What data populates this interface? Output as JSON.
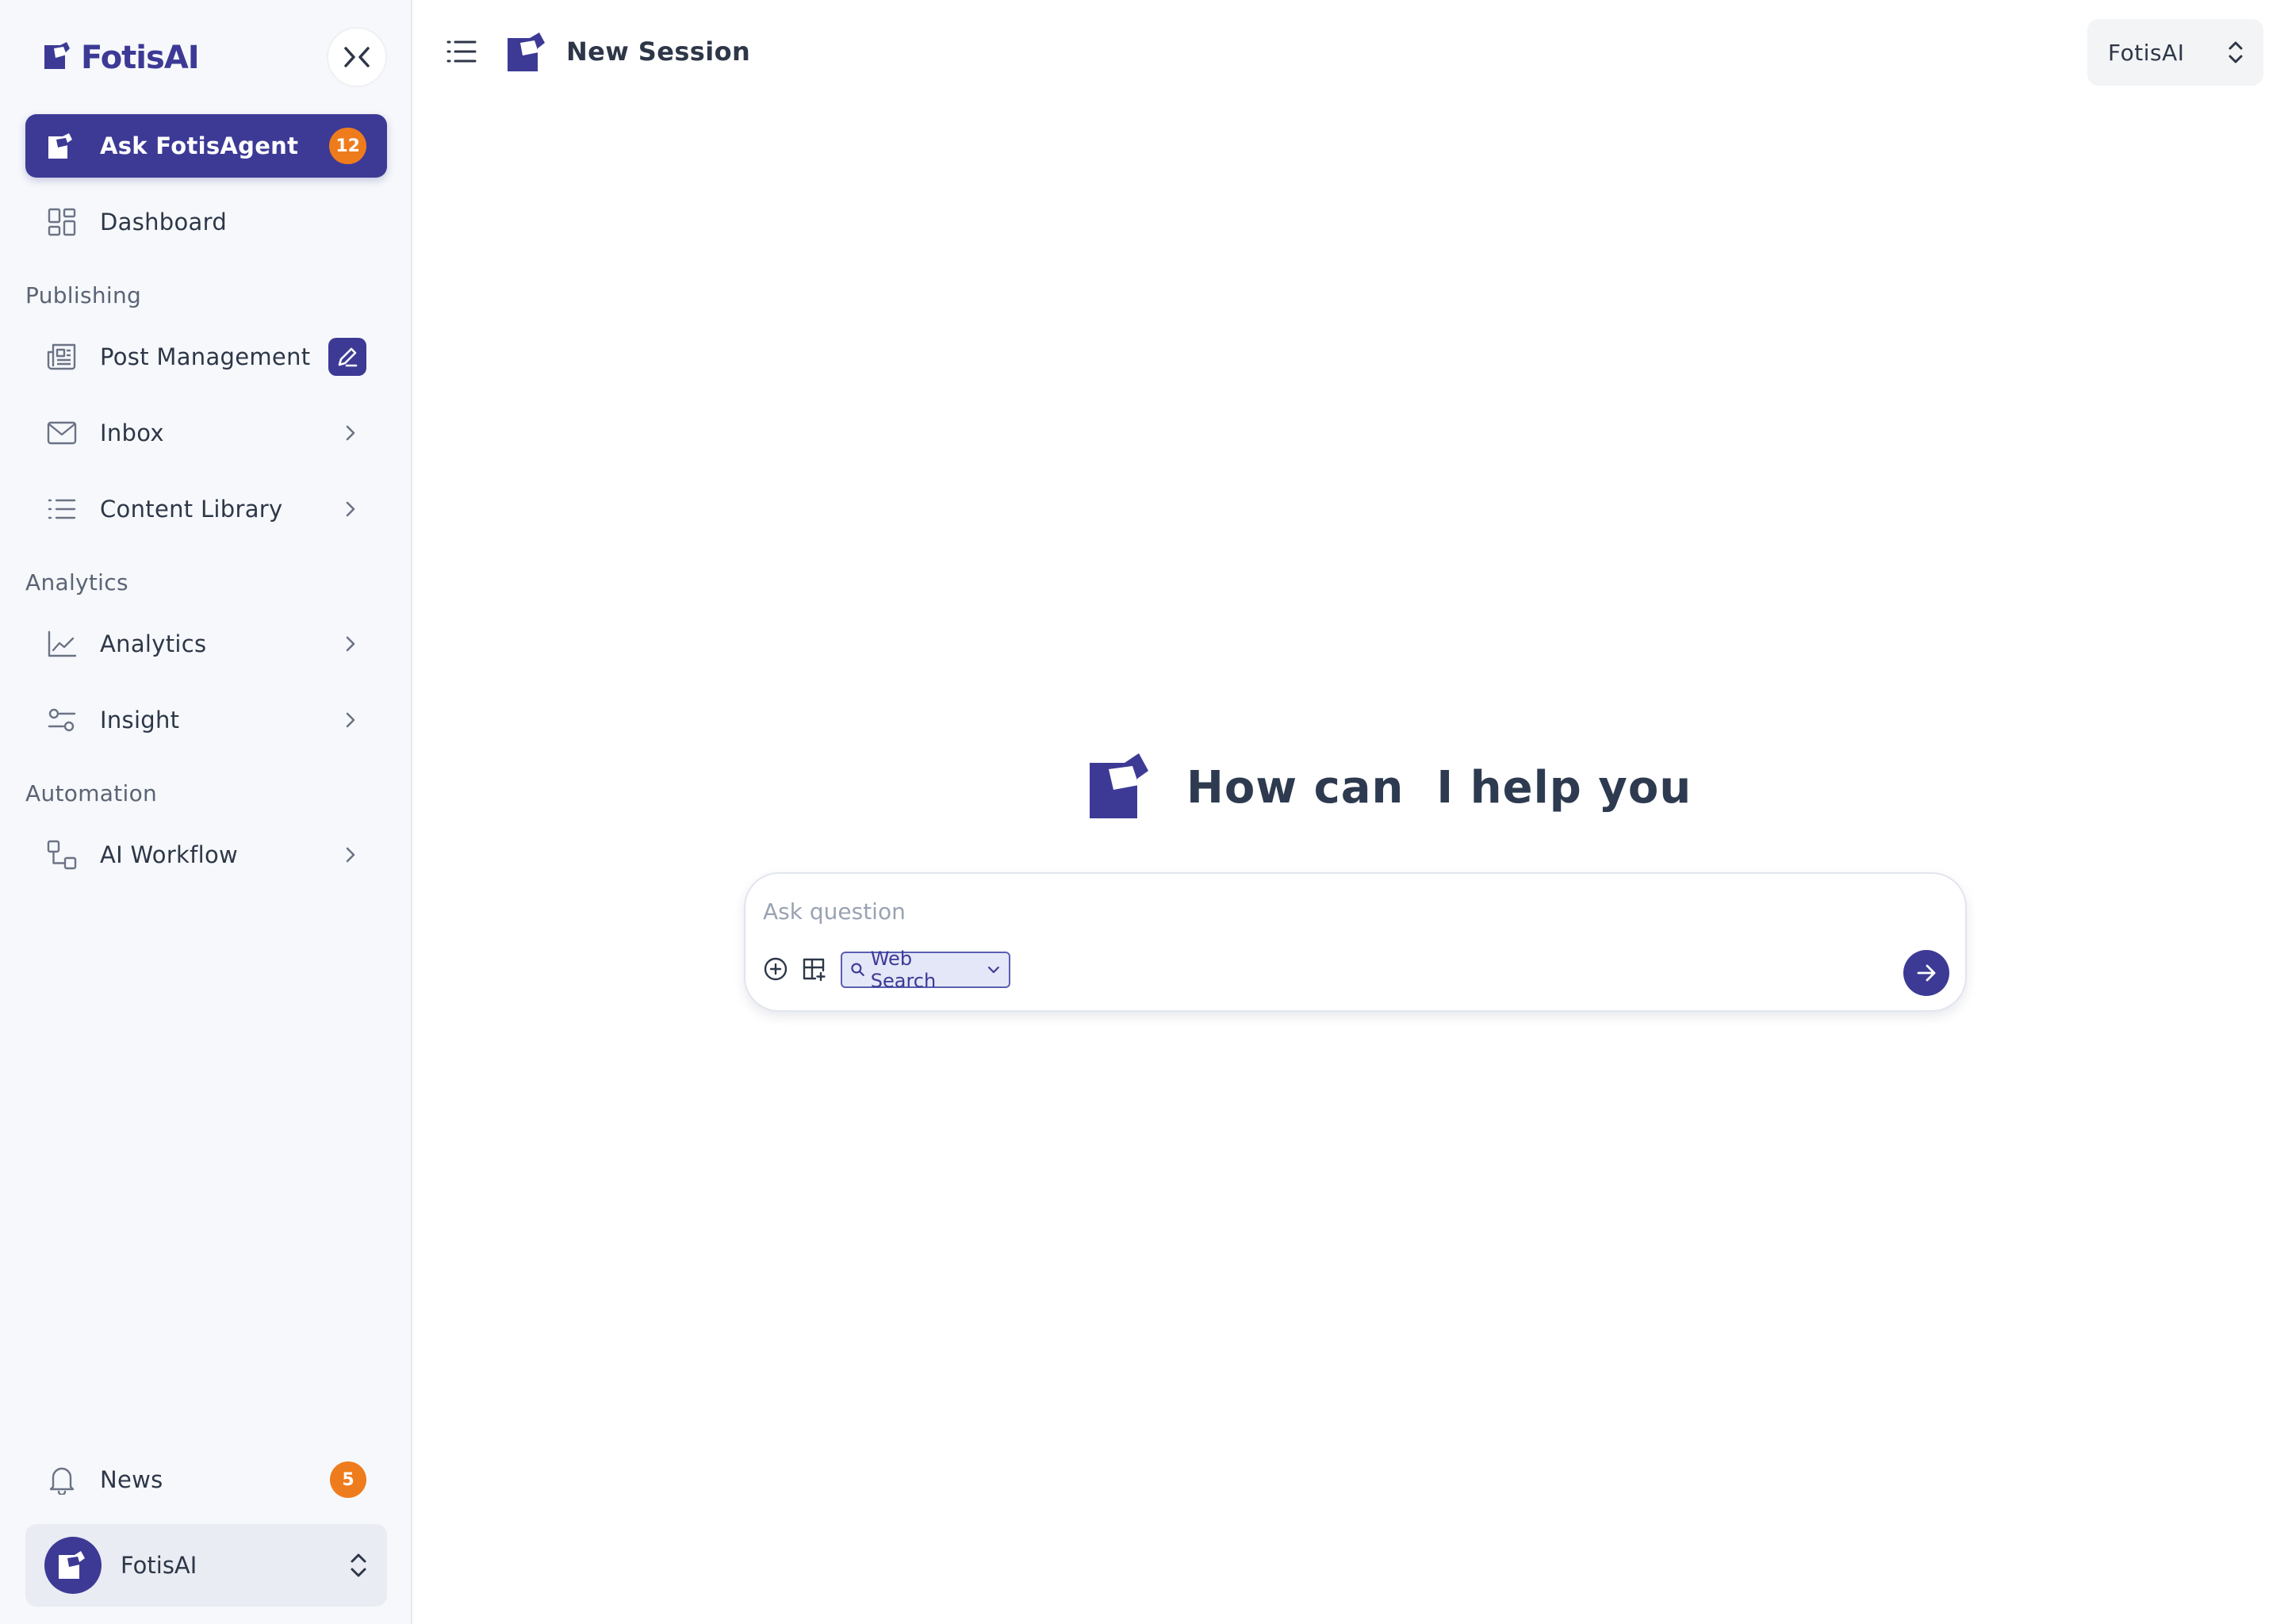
{
  "sidebar": {
    "brand": "FotisAI",
    "primary": {
      "label": "Ask FotisAgent",
      "badge": "12"
    },
    "dashboard": {
      "label": "Dashboard"
    },
    "sections": {
      "publishing": "Publishing",
      "analytics": "Analytics",
      "automation": "Automation"
    },
    "items": {
      "post_management": "Post Management",
      "inbox": "Inbox",
      "content_library": "Content Library",
      "analytics": "Analytics",
      "insight": "Insight",
      "ai_workflow": "AI Workflow"
    },
    "news": {
      "label": "News",
      "badge": "5"
    },
    "user": {
      "name": "FotisAI"
    }
  },
  "header": {
    "title": "New Session",
    "workspace": "FotisAI"
  },
  "hero": {
    "heading": "How can  I help you"
  },
  "chat": {
    "placeholder": "Ask question",
    "tool_label": "Web Search"
  },
  "colors": {
    "brand": "#3d3a96",
    "badge": "#ef7c1c",
    "sidebar_bg": "#f6f8fb"
  },
  "icons": [
    "logo-icon",
    "collapse-icon",
    "grid-icon",
    "newspaper-icon",
    "edit-icon",
    "mail-icon",
    "list-icon",
    "line-chart-icon",
    "sliders-icon",
    "workflow-icon",
    "chevron-right-icon",
    "bell-icon",
    "chevron-updown-icon",
    "plus-circle-icon",
    "table-add-icon",
    "search-icon",
    "chevron-down-icon",
    "arrow-right-icon"
  ]
}
